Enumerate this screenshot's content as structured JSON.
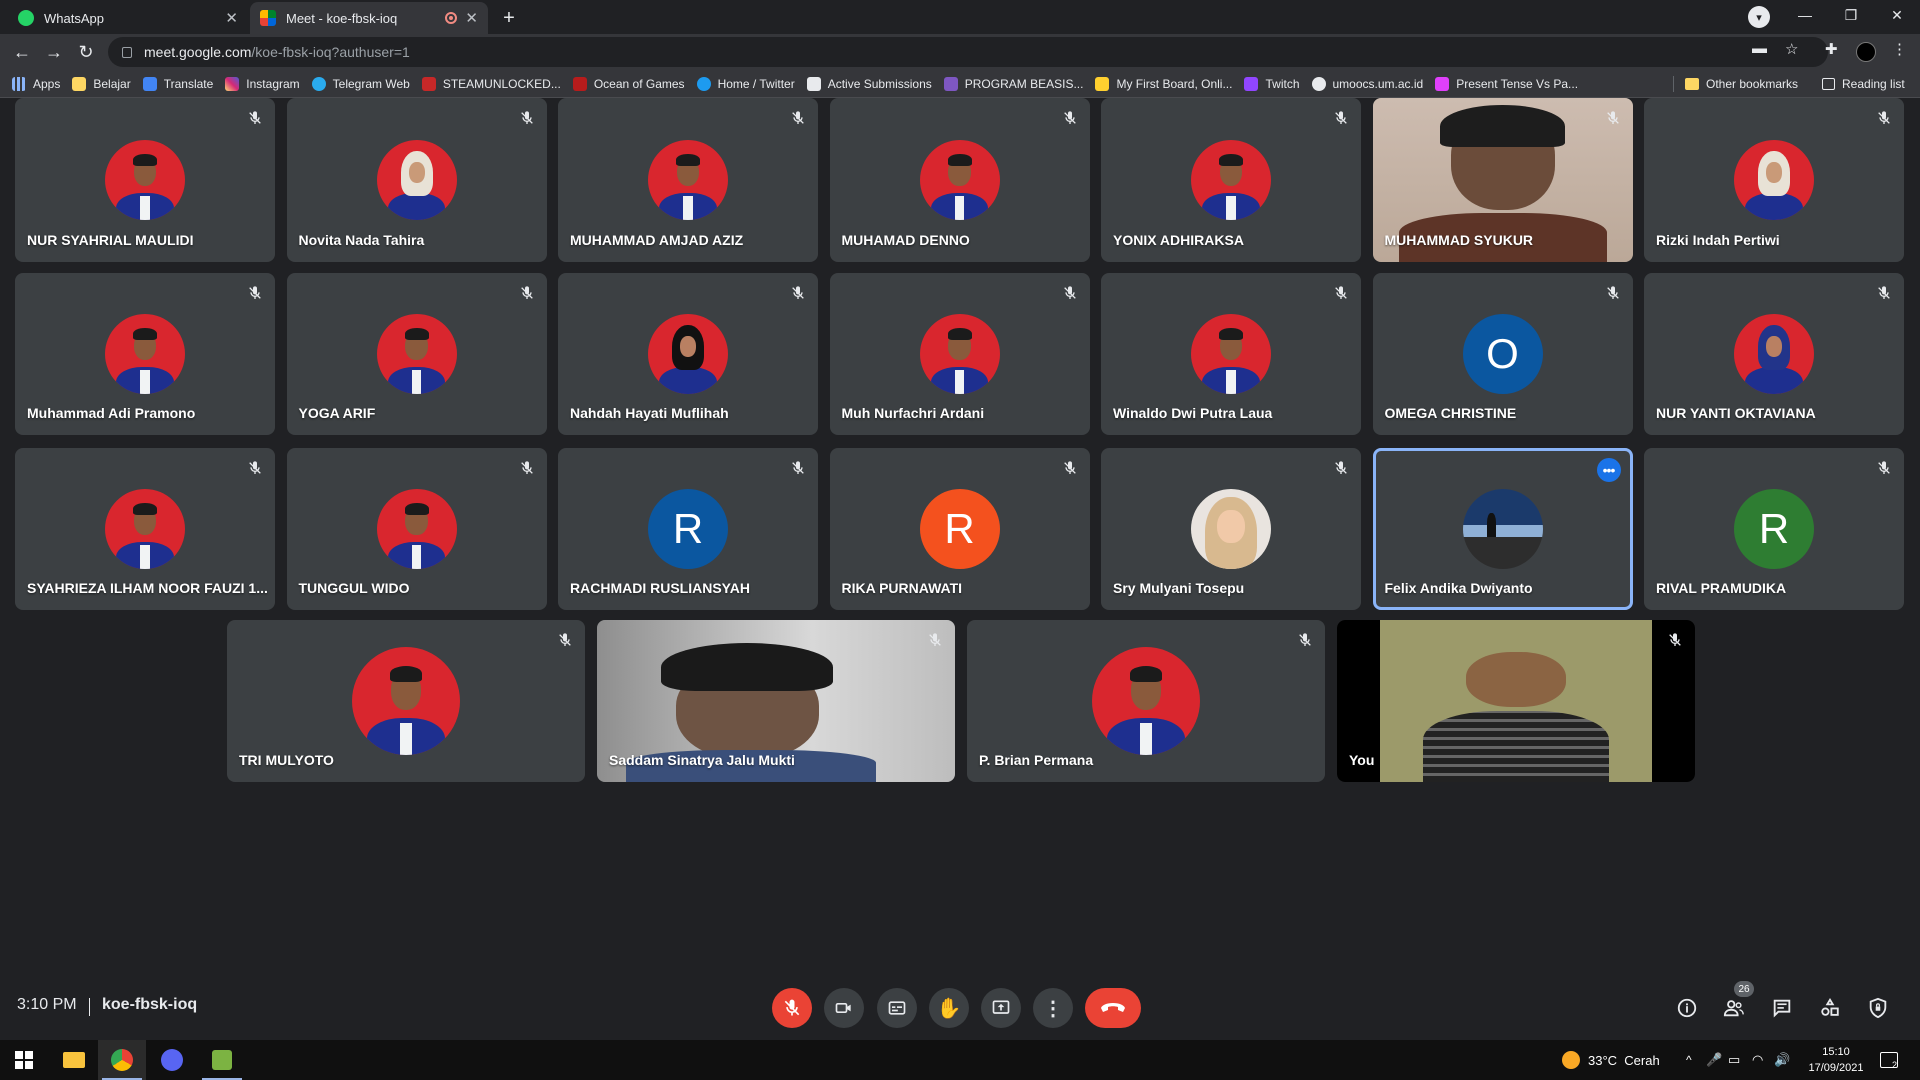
{
  "browser": {
    "tabs": [
      {
        "label": "WhatsApp",
        "active": false
      },
      {
        "label": "Meet - koe-fbsk-ioq",
        "active": true
      }
    ],
    "url_host": "meet.google.com",
    "url_path": "/koe-fbsk-ioq?authuser=1",
    "bookmarks": [
      "Apps",
      "Belajar",
      "Translate",
      "Instagram",
      "Telegram Web",
      "STEAMUNLOCKED...",
      "Ocean of Games",
      "Home / Twitter",
      "Active Submissions",
      "PROGRAM BEASIS...",
      "My First Board, Onli...",
      "Twitch",
      "umoocs.um.ac.id",
      "Present Tense Vs Pa..."
    ],
    "other_bookmarks": "Other bookmarks",
    "reading_list": "Reading list"
  },
  "participants": [
    {
      "name": "NUR SYAHRIAL MAULIDI",
      "kind": "photo"
    },
    {
      "name": "Novita Nada Tahira",
      "kind": "photo-hijab"
    },
    {
      "name": "MUHAMMAD AMJAD AZIZ",
      "kind": "photo"
    },
    {
      "name": "MUHAMAD DENNO",
      "kind": "photo"
    },
    {
      "name": "YONIX ADHIRAKSA",
      "kind": "photo"
    },
    {
      "name": "MUHAMMAD SYUKUR",
      "kind": "video"
    },
    {
      "name": "Rizki Indah Pertiwi",
      "kind": "photo-hijab"
    },
    {
      "name": "Muhammad Adi Pramono",
      "kind": "photo"
    },
    {
      "name": "YOGA ARIF",
      "kind": "photo"
    },
    {
      "name": "Nahdah Hayati Muflihah",
      "kind": "photo-hijab-dark"
    },
    {
      "name": "Muh Nurfachri Ardani",
      "kind": "photo"
    },
    {
      "name": "Winaldo Dwi Putra Laua",
      "kind": "photo"
    },
    {
      "name": "OMEGA CHRISTINE",
      "kind": "initial",
      "initial": "O",
      "color": "#0b57a0"
    },
    {
      "name": "NUR YANTI OKTAVIANA",
      "kind": "photo-hijab-blue"
    },
    {
      "name": "SYAHRIEZA ILHAM NOOR FAUZI 1...",
      "kind": "photo"
    },
    {
      "name": "TUNGGUL WIDO",
      "kind": "photo"
    },
    {
      "name": "RACHMADI RUSLIANSYAH",
      "kind": "initial",
      "initial": "R",
      "color": "#0b57a0"
    },
    {
      "name": "RIKA PURNAWATI",
      "kind": "initial",
      "initial": "R",
      "color": "#f4511e"
    },
    {
      "name": "Sry Mulyani Tosepu",
      "kind": "photo-light"
    },
    {
      "name": "Felix Andika Dwiyanto",
      "kind": "photo-landscape",
      "speaking": true
    },
    {
      "name": "RIVAL PRAMUDIKA",
      "kind": "initial",
      "initial": "R",
      "color": "#2e7d32"
    },
    {
      "name": "TRI MULYOTO",
      "kind": "photo"
    },
    {
      "name": "Saddam Sinatrya Jalu Mukti",
      "kind": "video"
    },
    {
      "name": "P. Brian Permana",
      "kind": "photo"
    },
    {
      "name": "You",
      "kind": "video"
    }
  ],
  "meeting": {
    "time": "3:10 PM",
    "code": "koe-fbsk-ioq",
    "people_count": "26"
  },
  "taskbar": {
    "weather": "33°C  Cerah",
    "time": "15:10",
    "date": "17/09/2021",
    "notifications": "2"
  }
}
